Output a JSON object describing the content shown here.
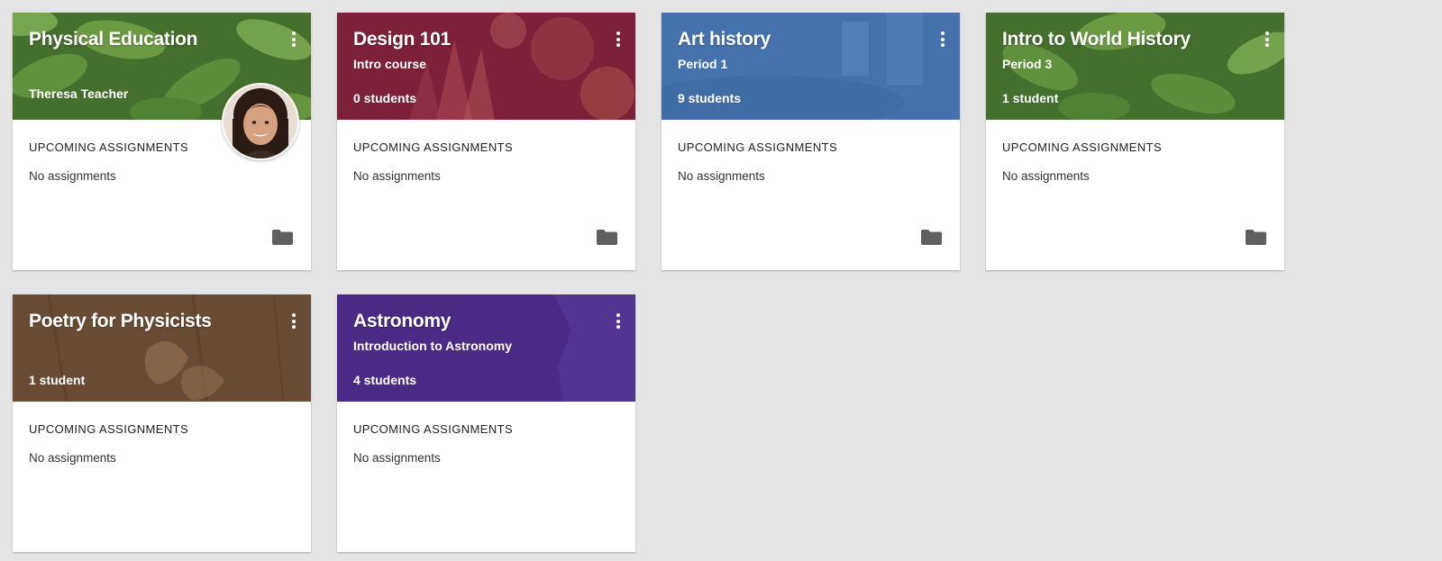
{
  "classes": [
    {
      "title": "Physical Education",
      "subtitle": "",
      "teacher": "Theresa Teacher",
      "count": "",
      "upcoming": "UPCOMING ASSIGNMENTS",
      "assignments": "No assignments",
      "theme": "#5b8d3a"
    },
    {
      "title": "Design 101",
      "subtitle": "Intro course",
      "teacher": "",
      "count": "0 students",
      "upcoming": "UPCOMING ASSIGNMENTS",
      "assignments": "No assignments",
      "theme": "#8a2440"
    },
    {
      "title": "Art history",
      "subtitle": "Period 1",
      "teacher": "",
      "count": "9 students",
      "upcoming": "UPCOMING ASSIGNMENTS",
      "assignments": "No assignments",
      "theme": "#4e7fbf"
    },
    {
      "title": "Intro to World History",
      "subtitle": "Period 3",
      "teacher": "",
      "count": "1 student",
      "upcoming": "UPCOMING ASSIGNMENTS",
      "assignments": "No assignments",
      "theme": "#5b8d3a"
    },
    {
      "title": "Poetry for Physicists",
      "subtitle": "",
      "teacher": "",
      "count": "1 student",
      "upcoming": "UPCOMING ASSIGNMENTS",
      "assignments": "No assignments",
      "theme": "#7a5a40"
    },
    {
      "title": "Astronomy",
      "subtitle": "Introduction to Astronomy",
      "teacher": "",
      "count": "4 students",
      "upcoming": "UPCOMING ASSIGNMENTS",
      "assignments": "No assignments",
      "theme": "#4f2d8f"
    }
  ],
  "icons": {
    "menu": "more-vert-icon",
    "folder": "folder-icon"
  }
}
